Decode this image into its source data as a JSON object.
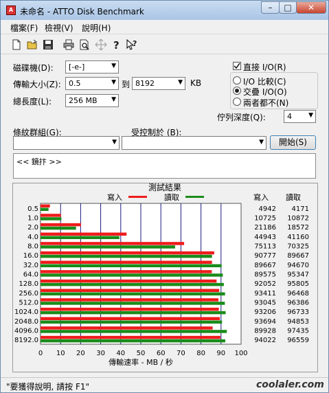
{
  "window": {
    "title": "未命名 - ATTO Disk Benchmark",
    "minimize": "–",
    "maximize": "□",
    "close": "✕"
  },
  "menu": [
    "檔案(F)",
    "檢視(V)",
    "說明(H)"
  ],
  "toolbar_icons": [
    "new-document-icon",
    "open-folder-icon",
    "save-icon",
    "print-icon",
    "print-preview-icon",
    "move-icon",
    "help-icon",
    "context-help-icon"
  ],
  "form": {
    "drive_label": "磁碟機(D):",
    "drive_value": "[-e-]",
    "transfer_label": "傳輸大小(Z):",
    "transfer_from": "0.5",
    "to_label": "到",
    "transfer_to": "8192",
    "kb_label": "KB",
    "length_label": "總長度(L):",
    "length_value": "256 MB",
    "direct_io_label": "直接 I/O(R)",
    "direct_io_checked": true,
    "radios": [
      {
        "label": "I/O 比較(C)",
        "checked": false
      },
      {
        "label": "交疊 I/O(O)",
        "checked": true
      },
      {
        "label": "兩者都不(N)",
        "checked": false
      }
    ],
    "queue_label": "佇列深度(Q):",
    "queue_value": "4",
    "pattern_label": "條紋群組(G):",
    "control_label": "受控制於 (B):",
    "start_button": "開始(S)",
    "description": "<< 鏡抃 >>"
  },
  "chart_data": {
    "type": "bar",
    "title": "測試結果",
    "legend": {
      "write": "寫入",
      "read": "讀取"
    },
    "colors": {
      "write": "#ee1c1c",
      "read": "#1a8c1a",
      "grid": "#1a1a80"
    },
    "categories": [
      "0.5",
      "1.0",
      "2.0",
      "4.0",
      "8.0",
      "16.0",
      "32.0",
      "64.0",
      "128.0",
      "256.0",
      "512.0",
      "1024.0",
      "2048.0",
      "4096.0",
      "8192.0"
    ],
    "series": [
      {
        "name": "寫入",
        "values": [
          4942,
          10725,
          21186,
          44943,
          75113,
          90777,
          89667,
          89575,
          92052,
          93411,
          93045,
          93206,
          93694,
          89928,
          94022
        ]
      },
      {
        "name": "讀取",
        "values": [
          4171,
          10872,
          18572,
          41160,
          70325,
          89667,
          94670,
          95347,
          95805,
          96468,
          96386,
          96733,
          94853,
          97435,
          96559
        ]
      }
    ],
    "bar_values_mb": {
      "write": [
        4.7,
        10.2,
        20.2,
        42.9,
        71.6,
        86.6,
        85.5,
        85.4,
        87.8,
        89.1,
        88.7,
        88.9,
        89.4,
        85.8,
        89.7
      ],
      "read": [
        4.0,
        10.4,
        17.7,
        39.3,
        67.1,
        85.5,
        90.3,
        90.9,
        91.4,
        92.0,
        91.9,
        92.3,
        90.5,
        92.9,
        92.1
      ]
    },
    "col_write_header": "寫入",
    "col_read_header": "讀取",
    "xlabel": "傳輸速率 - MB / 秒",
    "xticks": [
      "0",
      "10",
      "20",
      "30",
      "40",
      "50",
      "60",
      "70",
      "80",
      "90",
      "100"
    ],
    "xlim": [
      0,
      100
    ]
  },
  "status": {
    "text": "\"要獲得說明, 請按 F1\""
  },
  "watermark": "coolaler.com"
}
